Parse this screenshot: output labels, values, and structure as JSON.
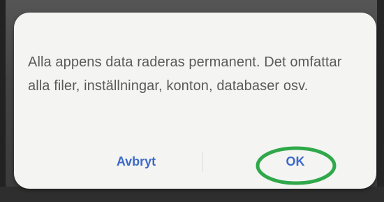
{
  "dialog": {
    "message": "Alla appens data raderas permanent. Det omfattar alla filer, inställningar, konton, databaser osv.",
    "cancel_label": "Avbryt",
    "ok_label": "OK"
  },
  "colors": {
    "dialog_background": "#f4f4f2",
    "button_text": "#3d69c9",
    "message_text": "#5a5a5a",
    "highlight_circle": "#2fa84a"
  }
}
